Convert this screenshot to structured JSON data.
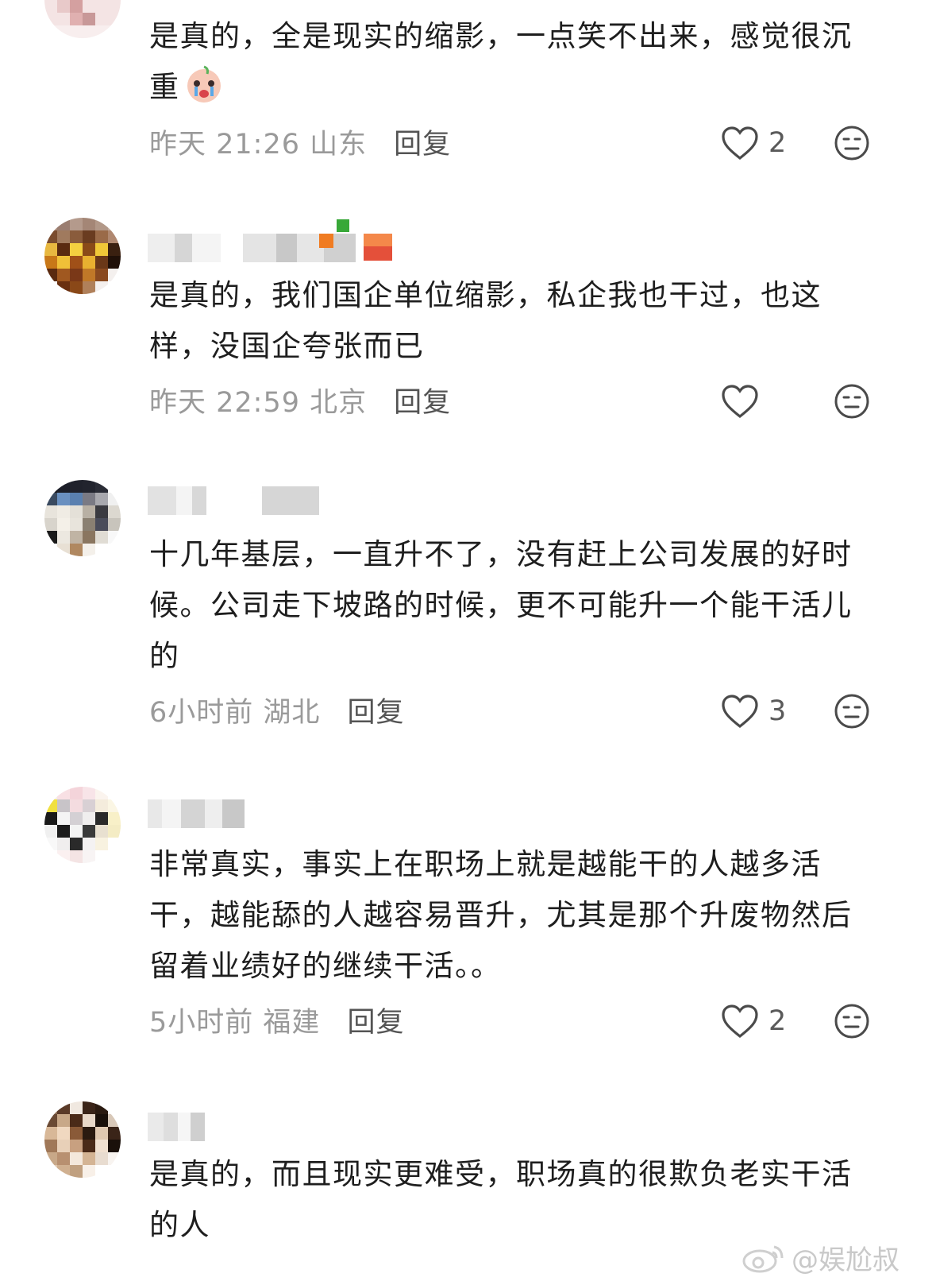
{
  "comments": [
    {
      "text": "是真的，全是现实的缩影，一点笑不出来，感觉很沉重",
      "time": "昨天 21:26",
      "location": "山东",
      "reply": "回复",
      "likes": "2"
    },
    {
      "text": "是真的，我们国企单位缩影，私企我也干过，也这样，没国企夸张而已",
      "time": "昨天 22:59",
      "location": "北京",
      "reply": "回复",
      "likes": ""
    },
    {
      "text": "十几年基层，一直升不了，没有赶上公司发展的好时候。公司走下坡路的时候，更不可能升一个能干活儿的",
      "time": "6小时前",
      "location": "湖北",
      "reply": "回复",
      "likes": "3"
    },
    {
      "text": "非常真实，事实上在职场上就是越能干的人越多活干，越能舔的人越容易晋升，尤其是那个升废物然后留着业绩好的继续干活。。",
      "time": "5小时前",
      "location": "福建",
      "reply": "回复",
      "likes": "2"
    },
    {
      "text": "是真的，而且现实更难受，职场真的很欺负老实干活的人",
      "time": "",
      "location": "",
      "reply": "",
      "likes": ""
    }
  ],
  "watermark": "@娱尬叔",
  "icons": {
    "like": "heart-outline-icon",
    "dislike": "neutral-face-icon",
    "emoji": "crying-face-emoji"
  },
  "colors": {
    "text": "#1e1e1e",
    "meta": "#9a9a9a",
    "reply": "#545454",
    "icon": "#4a4a4a"
  }
}
